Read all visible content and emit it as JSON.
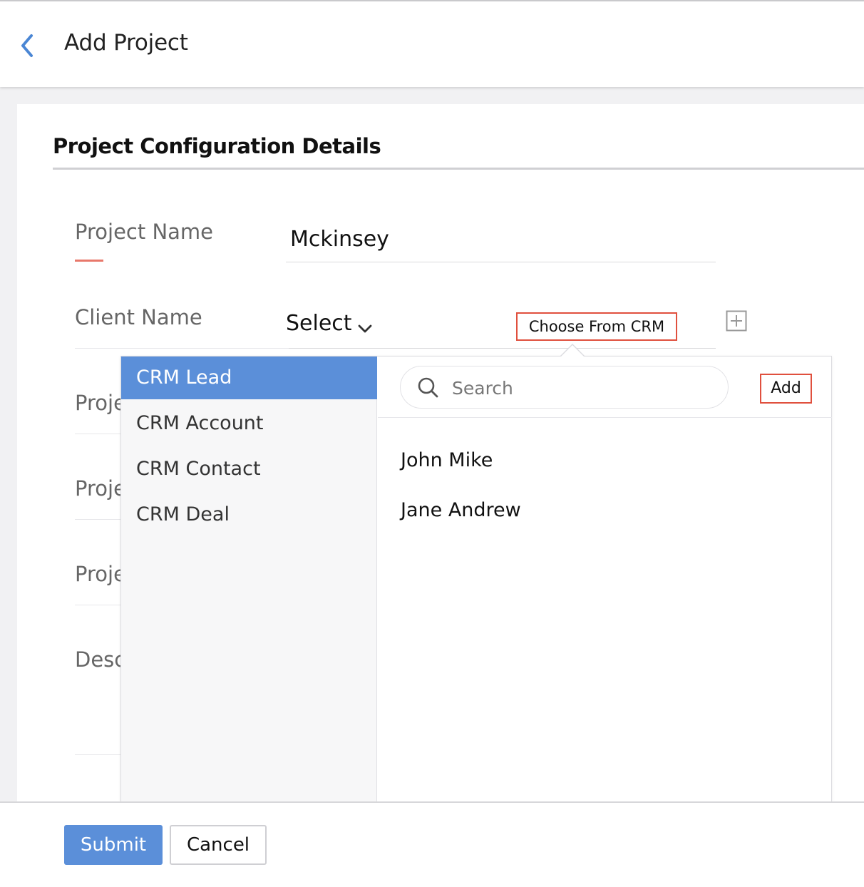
{
  "header": {
    "back_icon": "chevron-left-icon",
    "title": "Add Project"
  },
  "section": {
    "title": "Project Configuration Details"
  },
  "form": {
    "project_name_label": "Project Name",
    "project_name_value": "Mckinsey",
    "client_name_label": "Client Name",
    "client_select_value": "Select",
    "choose_crm_label": "Choose From CRM",
    "add_client_icon": "plus-square-icon",
    "project_field_3_label": "Proje",
    "project_field_4_label": "Proje",
    "project_field_5_label": "Proje",
    "description_label": "Desc"
  },
  "crm_dropdown": {
    "categories": [
      {
        "label": "CRM Lead",
        "selected": true
      },
      {
        "label": "CRM Account",
        "selected": false
      },
      {
        "label": "CRM Contact",
        "selected": false
      },
      {
        "label": "CRM Deal",
        "selected": false
      }
    ],
    "search": {
      "value": "",
      "placeholder": "Search"
    },
    "add_label": "Add",
    "results": [
      "John Mike",
      "Jane Andrew"
    ]
  },
  "footer": {
    "submit_label": "Submit",
    "cancel_label": "Cancel"
  },
  "colors": {
    "accent_blue": "#5b8fd9",
    "highlight_red": "#e0503e",
    "label_accent": "#e8786b"
  }
}
